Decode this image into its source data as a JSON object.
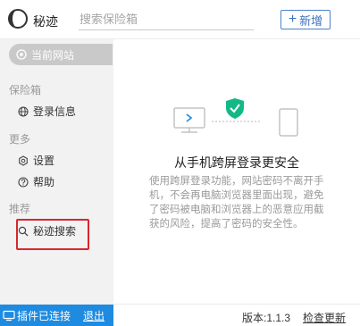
{
  "header": {
    "app_name": "秘迹",
    "search_placeholder": "搜索保险箱",
    "new_button_plus": "+",
    "new_button_label": "新增"
  },
  "sidebar": {
    "current_site_label": "当前网站",
    "groups": [
      {
        "label": "保险箱",
        "items": [
          {
            "label": "登录信息",
            "icon": "globe-icon"
          }
        ]
      },
      {
        "label": "更多",
        "items": [
          {
            "label": "设置",
            "icon": "gear-icon"
          },
          {
            "label": "帮助",
            "icon": "help-icon"
          }
        ]
      },
      {
        "label": "推荐",
        "items": [
          {
            "label": "秘迹搜索",
            "icon": "search-icon"
          }
        ]
      }
    ]
  },
  "main": {
    "promo_title": "从手机跨屏登录更安全",
    "promo_description": "使用跨屏登录功能，网站密码不离开手机，不会再电脑浏览器里面出现，避免了密码被电脑和浏览器上的恶意应用截获的风险，提高了密码的安全性。"
  },
  "footer": {
    "connection_status": "插件已连接",
    "logout_label": "退出",
    "version_label": "版本:1.1.3",
    "check_update_label": "检查更新"
  },
  "colors": {
    "accent": "#1e8be0",
    "button_border": "#4a82c8",
    "shield": "#14b886",
    "highlight_box": "#d9262d",
    "sidebar_bg": "#f2f2f2"
  }
}
